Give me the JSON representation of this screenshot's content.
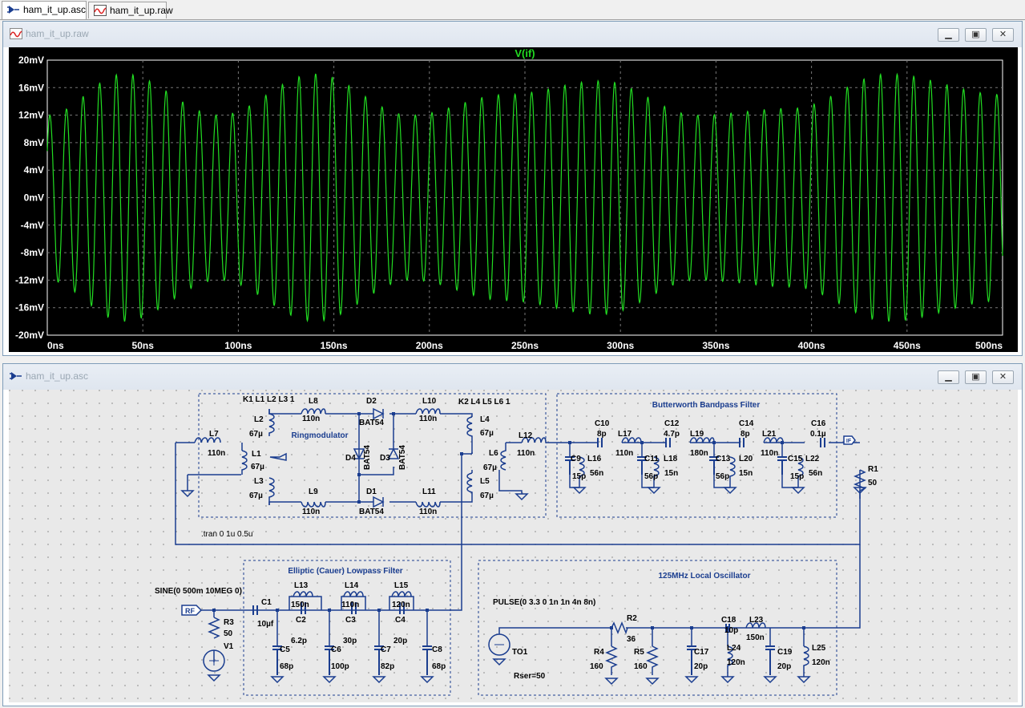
{
  "tabs": [
    {
      "label": "ham_it_up.asc",
      "icon": "schematic-icon"
    },
    {
      "label": "ham_it_up.raw",
      "icon": "waveform-icon"
    }
  ],
  "waveform_window": {
    "title": "ham_it_up.raw",
    "trace_label": "V(if)",
    "trace_color": "#22dd22",
    "buttons": {
      "minimize": "minimize-icon",
      "restore": "restore-icon",
      "close": "close-icon"
    }
  },
  "schematic_window": {
    "title": "ham_it_up.asc",
    "buttons": {
      "minimize": "minimize-icon",
      "restore": "restore-icon",
      "close": "close-icon"
    }
  },
  "chart_data": {
    "type": "line",
    "title": "V(if)",
    "x_ticks": [
      "0ns",
      "50ns",
      "100ns",
      "150ns",
      "200ns",
      "250ns",
      "300ns",
      "350ns",
      "400ns",
      "450ns",
      "500ns"
    ],
    "y_ticks": [
      "20mV",
      "16mV",
      "12mV",
      "8mV",
      "4mV",
      "0mV",
      "-4mV",
      "-8mV",
      "-12mV",
      "-16mV",
      "-20mV"
    ],
    "xlim": [
      0,
      500
    ],
    "ylim": [
      -20,
      20
    ],
    "x_unit": "ns",
    "y_unit": "mV",
    "grid": true,
    "series": [
      {
        "name": "V(if)",
        "carrier_frequency_mhz": 115,
        "envelope_peaks_mv": [
          {
            "x": 0,
            "y": 12
          },
          {
            "x": 40,
            "y": 18
          },
          {
            "x": 90,
            "y": 12
          },
          {
            "x": 140,
            "y": 18
          },
          {
            "x": 190,
            "y": 12
          },
          {
            "x": 240,
            "y": 15
          },
          {
            "x": 290,
            "y": 17
          },
          {
            "x": 340,
            "y": 12
          },
          {
            "x": 390,
            "y": 13
          },
          {
            "x": 440,
            "y": 18
          },
          {
            "x": 500,
            "y": 15
          }
        ]
      }
    ]
  },
  "schematic": {
    "blocks": {
      "ringmod": "Ringmodulator",
      "bandpass": "Butterworth Bandpass Filter",
      "lowpass": "Elliptic (Cauer) Lowpass Filter",
      "oscillator": "125MHz Local Oscillator"
    },
    "directives": {
      "k1": "K1 L1 L2 L3 1",
      "k2": "K2 L4 L5 L6 1",
      "tran": ".tran 0 1u 0.5u",
      "sine": "SINE(0 500m 10MEG 0)",
      "pulse": "PULSE(0 3.3 0 1n 1n 4n 8n)"
    },
    "ports": {
      "rf": "RF",
      "if": "IF"
    },
    "labels": {
      "L7": "L7",
      "L7v": "110n",
      "L2": "L2",
      "L2v": "67µ",
      "L1": "L1",
      "L1v": "67µ",
      "L3": "L3",
      "L3v": "67µ",
      "L8": "L8",
      "L8v": "110n",
      "L9": "L9",
      "L9v": "110n",
      "D2": "D2",
      "D2v": "BAT54",
      "D1": "D1",
      "D1v": "BAT54",
      "D4": "D4",
      "D4v": "BAT54",
      "D3": "D3",
      "D3v": "BAT54",
      "L10": "L10",
      "L10v": "110n",
      "L11": "L11",
      "L11v": "110n",
      "L4": "L4",
      "L4v": "67µ",
      "L5": "L5",
      "L5v": "67µ",
      "L6": "L6",
      "L6v": "67µ",
      "L12": "L12",
      "L12v": "110n",
      "C9": "C9",
      "C9v": "15p",
      "L16": "L16",
      "L16v": "56n",
      "C10": "C10",
      "C10v": "8p",
      "L17": "L17",
      "L17v": "110n",
      "C11": "C11",
      "C11v": "56p",
      "L18": "L18",
      "L18v": "15n",
      "C12": "C12",
      "C12v": "4.7p",
      "L19": "L19",
      "L19v": "180n",
      "C13": "C13",
      "C13v": "56p",
      "L20": "L20",
      "L20v": "15n",
      "C14": "C14",
      "C14v": "8p",
      "L21": "L21",
      "L21v": "110n",
      "C15": "C15",
      "C15v": "15p",
      "L22": "L22",
      "L22v": "56n",
      "C16": "C16",
      "C16v": "0.1µ",
      "R1": "R1",
      "R1v": "50",
      "R3": "R3",
      "R3v": "50",
      "V1": "V1",
      "C1": "C1",
      "C1v": "10µf",
      "L13": "L13",
      "L13v": "150n",
      "C2": "C2",
      "C2v": "6.2p",
      "L14": "L14",
      "L14v": "110n",
      "C3": "C3",
      "C3v": "30p",
      "L15": "L15",
      "L15v": "120n",
      "C4": "C4",
      "C4v": "20p",
      "C5": "C5",
      "C5v": "68p",
      "C6": "C6",
      "C6v": "100p",
      "C7": "C7",
      "C7v": "82p",
      "C8": "C8",
      "C8v": "68p",
      "TO1": "TO1",
      "TO1v": "Rser=50",
      "R4": "R4",
      "R4v": "160",
      "R2": "R2",
      "R2v": "36",
      "R5": "R5",
      "R5v": "160",
      "C17": "C17",
      "C17v": "20p",
      "C18": "C18",
      "C18v": "10p",
      "L24": "L24",
      "L24v": "120n",
      "L23": "L23",
      "L23v": "150n",
      "C19": "C19",
      "C19v": "20p",
      "L25": "L25",
      "L25v": "120n"
    }
  }
}
